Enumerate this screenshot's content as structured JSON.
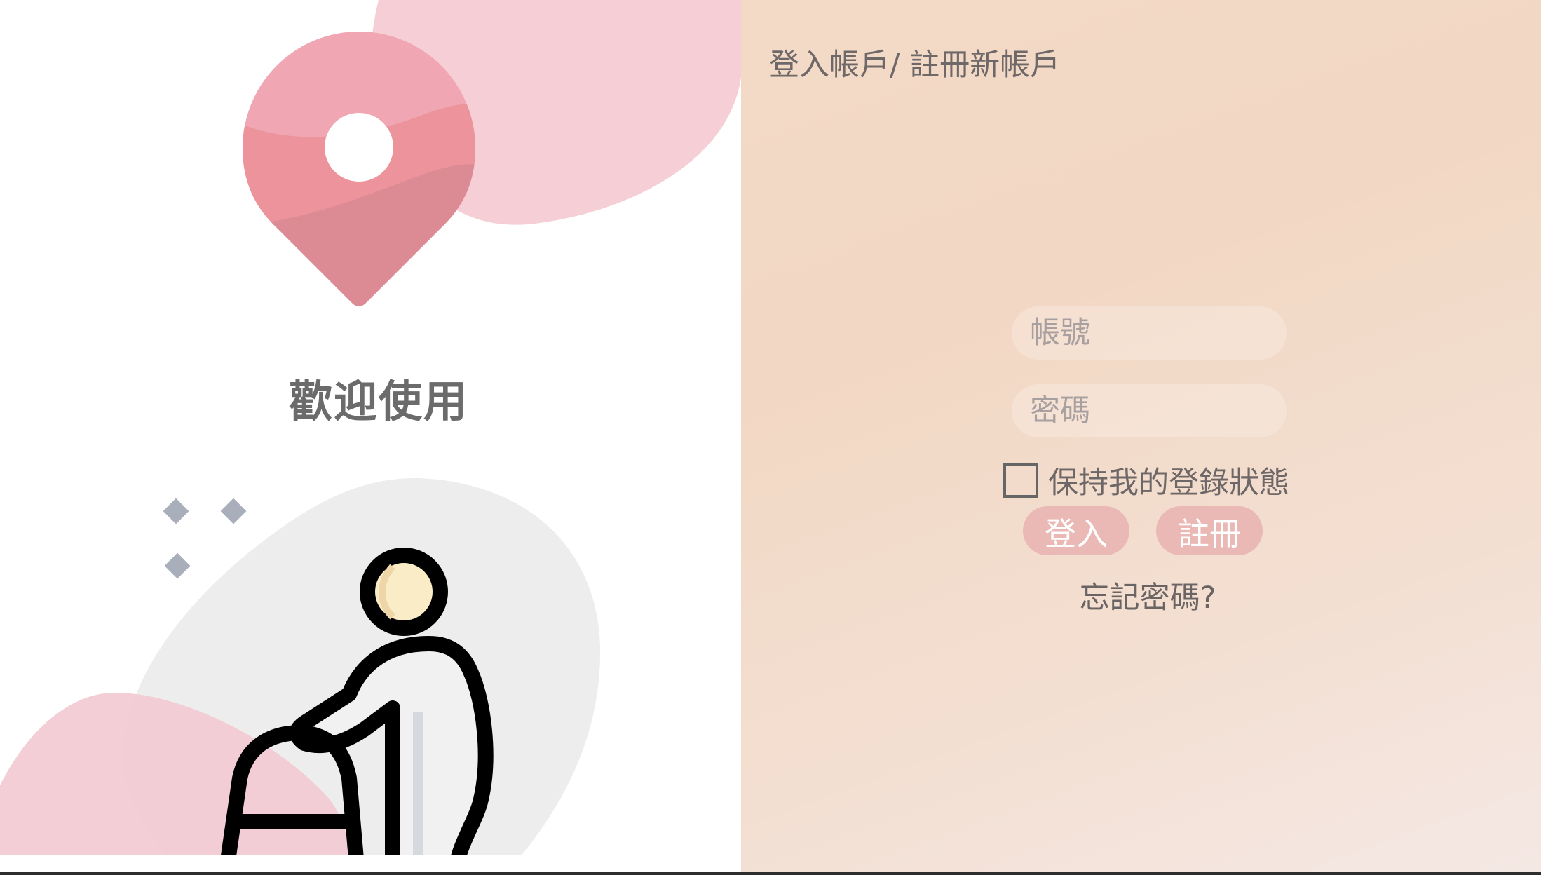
{
  "welcome": {
    "title": "歡迎使用"
  },
  "header": {
    "title": "登入帳戶/ 註冊新帳戶"
  },
  "form": {
    "account_placeholder": "帳號",
    "password_placeholder": "密碼",
    "remember_label": "保持我的登錄狀態",
    "remember_checked": false,
    "login_label": "登入",
    "register_label": "註冊",
    "forgot_label": "忘記密碼?"
  },
  "colors": {
    "accent_button": "#eab9b6",
    "pin_pink": "#ec939c",
    "blob_pink": "#f6cfd6",
    "panel_peach": "#f2d8c4",
    "text_gray": "#6b6b6b"
  },
  "icons": [
    "location-pin-icon",
    "elderly-walker-icon"
  ]
}
